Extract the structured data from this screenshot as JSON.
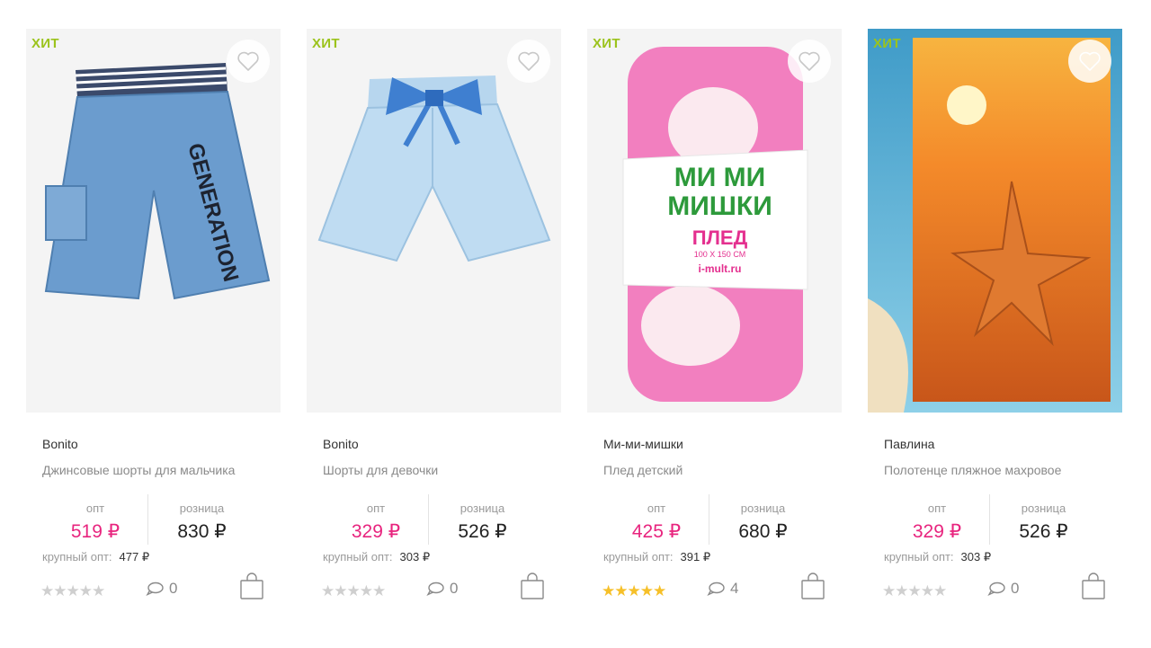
{
  "products": [
    {
      "badge": "ХИТ",
      "image": "jeans-shorts-image",
      "brand": "Bonito",
      "title": "Джинсовые шорты для мальчика",
      "price_opt_label": "опт",
      "price_opt": "519 ₽",
      "price_retail_label": "розница",
      "price_retail": "830 ₽",
      "bulk_label": "крупный опт:",
      "bulk_price": "477 ₽",
      "rating": 0,
      "comments": "0"
    },
    {
      "badge": "ХИТ",
      "image": "girls-shorts-image",
      "brand": "Bonito",
      "title": "Шорты для девочки",
      "price_opt_label": "опт",
      "price_opt": "329 ₽",
      "price_retail_label": "розница",
      "price_retail": "526 ₽",
      "bulk_label": "крупный опт:",
      "bulk_price": "303 ₽",
      "rating": 0,
      "comments": "0"
    },
    {
      "badge": "ХИТ",
      "image": "kids-blanket-image",
      "brand": "Ми-ми-мишки",
      "title": "Плед детский",
      "price_opt_label": "опт",
      "price_opt": "425 ₽",
      "price_retail_label": "розница",
      "price_retail": "680 ₽",
      "bulk_label": "крупный опт:",
      "bulk_price": "391 ₽",
      "rating": 5,
      "comments": "4",
      "package_text": {
        "line1": "МИ МИ",
        "line2": "МИШКИ",
        "line3": "ПЛЕД",
        "line4": "100 X 150 СМ",
        "line5": "i-mult.ru"
      }
    },
    {
      "badge": "ХИТ",
      "image": "beach-towel-image",
      "brand": "Павлина",
      "title": "Полотенце пляжное махровое",
      "price_opt_label": "опт",
      "price_opt": "329 ₽",
      "price_retail_label": "розница",
      "price_retail": "526 ₽",
      "bulk_label": "крупный опт:",
      "bulk_price": "303 ₽",
      "rating": 0,
      "comments": "0"
    }
  ],
  "icons": {
    "favorite": "heart-icon",
    "comments": "comment-icon",
    "cart": "shopping-bag-icon",
    "star": "star-icon"
  },
  "colors": {
    "badge": "#9bc31c",
    "opt_price": "#e8247e",
    "star_on": "#f6c029",
    "star_off": "#cfcfcf"
  }
}
